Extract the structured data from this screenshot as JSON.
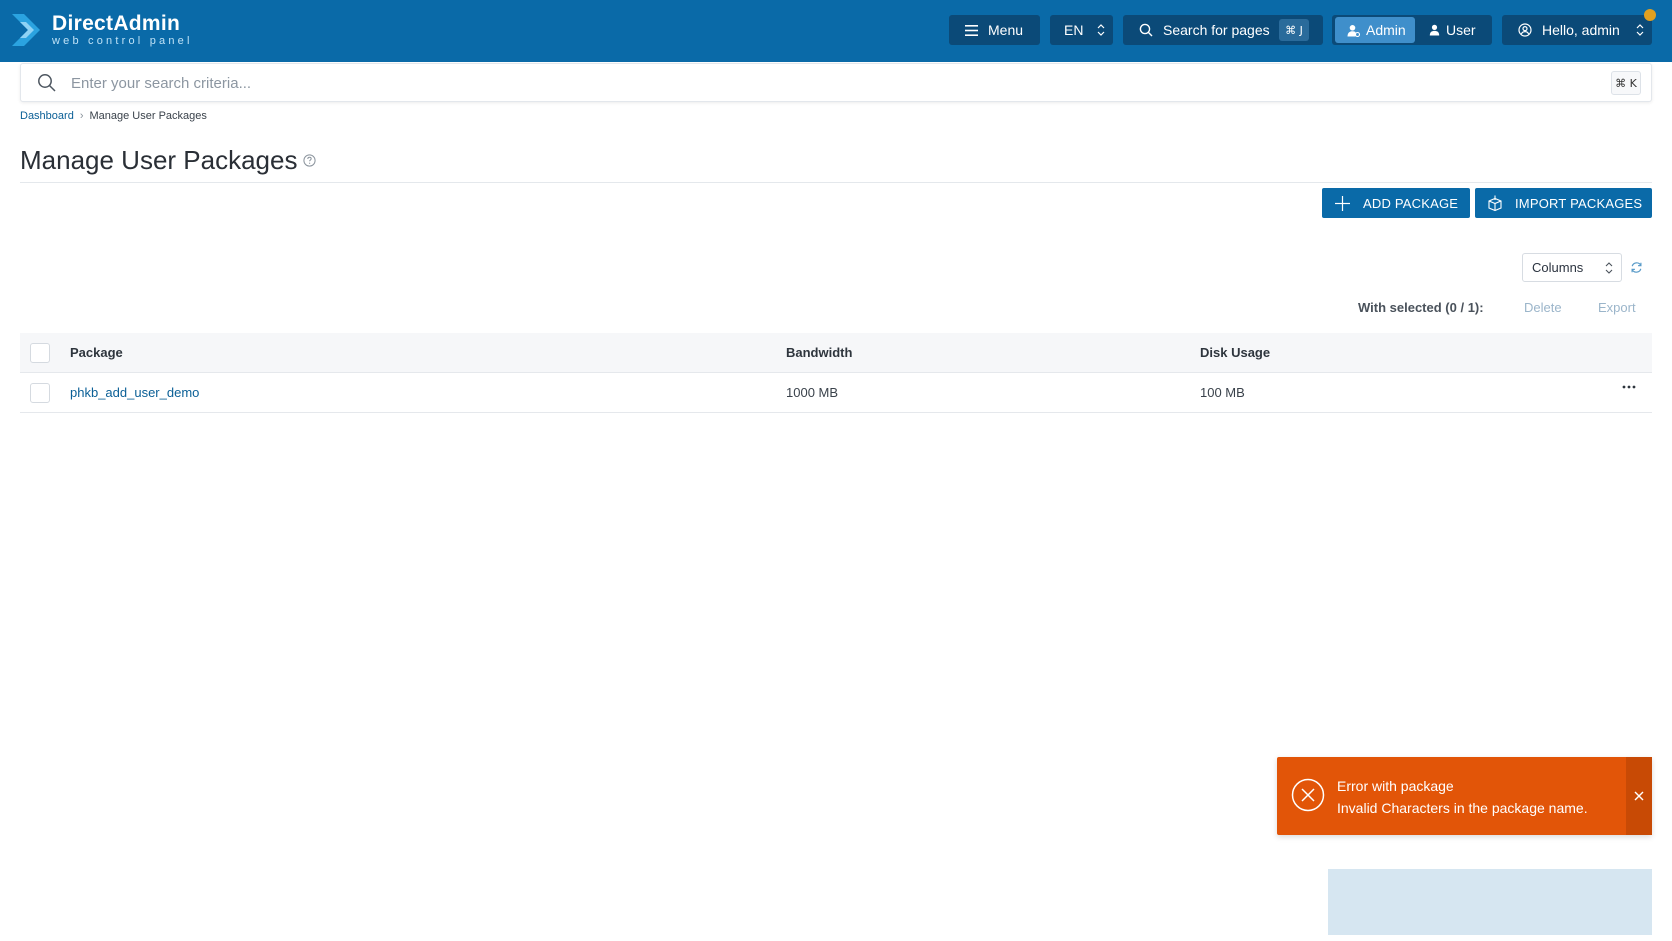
{
  "brand": {
    "name": "DirectAdmin",
    "tagline": "web control panel"
  },
  "header": {
    "menu_label": "Menu",
    "lang_label": "EN",
    "search_pages_label": "Search for pages",
    "search_pages_shortcut": "⌘ J",
    "role_admin": "Admin",
    "role_user": "User",
    "greeting": "Hello, admin"
  },
  "search": {
    "placeholder": "Enter your search criteria...",
    "shortcut": "⌘ K"
  },
  "breadcrumb": {
    "root": "Dashboard",
    "current": "Manage User Packages"
  },
  "page": {
    "title": "Manage User Packages"
  },
  "actions": {
    "add_package": "ADD PACKAGE",
    "import_packages": "IMPORT PACKAGES",
    "columns": "Columns",
    "with_selected": "With selected (0 / 1):",
    "delete": "Delete",
    "export": "Export"
  },
  "table": {
    "columns": [
      "Package",
      "Bandwidth",
      "Disk Usage"
    ],
    "rows": [
      {
        "package": "phkb_add_user_demo",
        "bandwidth": "1000 MB",
        "disk_usage": "100 MB"
      }
    ]
  },
  "toast": {
    "title": "Error with package",
    "message": "Invalid Characters in the package name."
  },
  "colors": {
    "header_bg": "#0a6aa8",
    "header_btn_bg": "#0b4a78",
    "role_active_bg": "#3f8fcb",
    "primary": "#0a6aa8",
    "link": "#0a5f96",
    "toast_error": "#e25508",
    "notification_dot": "#e0a020"
  },
  "icons": {
    "logo": "directadmin-chevron-logo",
    "menu": "hamburger-icon",
    "search": "search-icon",
    "admin": "admin-user-icon",
    "user": "user-icon",
    "account": "user-circle-icon",
    "help": "help-circle-icon",
    "add": "plus-icon",
    "import": "import-box-icon",
    "refresh": "refresh-icon",
    "row_actions": "more-horizontal-icon",
    "error": "error-circle-icon",
    "close": "close-icon"
  }
}
